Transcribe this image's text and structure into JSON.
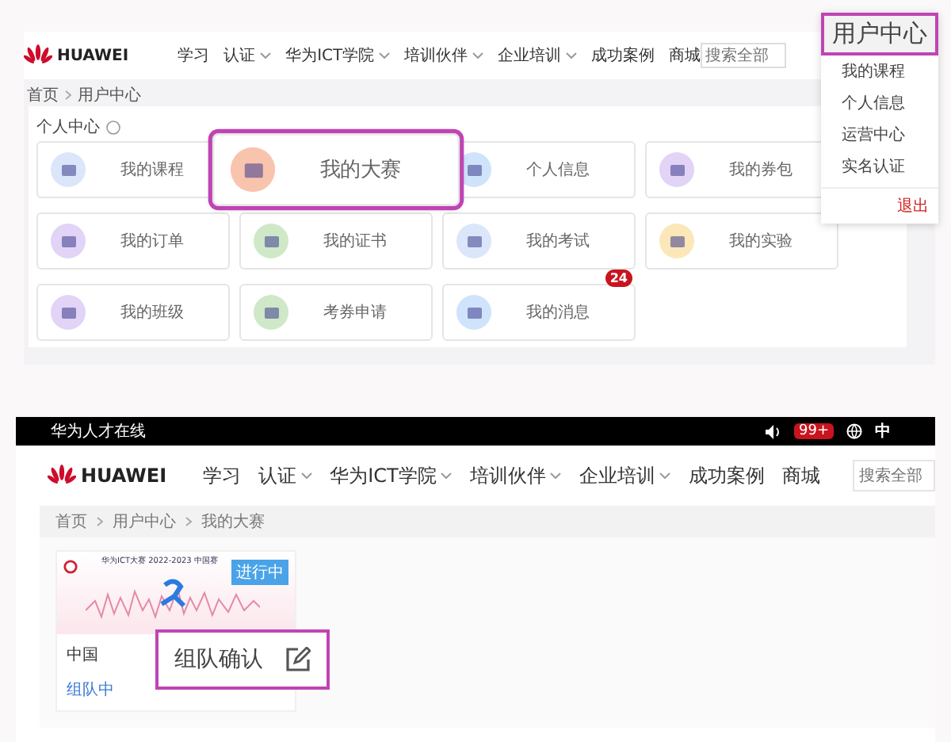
{
  "top": {
    "logo": "HUAWEI",
    "nav": [
      {
        "label": "学习",
        "dropdown": false
      },
      {
        "label": "认证",
        "dropdown": true
      },
      {
        "label": "华为ICT学院",
        "dropdown": true
      },
      {
        "label": "培训伙伴",
        "dropdown": true
      },
      {
        "label": "企业培训",
        "dropdown": true
      },
      {
        "label": "成功案例",
        "dropdown": false
      },
      {
        "label": "商城",
        "dropdown": false
      }
    ],
    "search": {
      "placeholder": "搜索全部"
    },
    "breadcrumb": [
      "首页",
      "用户中心"
    ],
    "section_title": "个人中心",
    "tiles": [
      {
        "label": "我的课程",
        "color": "#dbe6fb",
        "highlighted": false
      },
      {
        "label": "我的大赛",
        "color": "#f9c4ae",
        "highlighted": true
      },
      {
        "label": "个人信息",
        "color": "#cfe3fb",
        "highlighted": false
      },
      {
        "label": "我的券包",
        "color": "#e1d4f7",
        "highlighted": false
      },
      {
        "label": "我的订单",
        "color": "#e1d4f7",
        "highlighted": false
      },
      {
        "label": "我的证书",
        "color": "#cfe8c8",
        "highlighted": false
      },
      {
        "label": "我的考试",
        "color": "#dbe6fb",
        "highlighted": false
      },
      {
        "label": "我的实验",
        "color": "#fbe7b8",
        "highlighted": false
      },
      {
        "label": "我的班级",
        "color": "#e1d4f7",
        "highlighted": false
      },
      {
        "label": "考券申请",
        "color": "#cfe8c8",
        "highlighted": false
      },
      {
        "label": "我的消息",
        "color": "#cfe3fb",
        "highlighted": false,
        "badge": "24"
      }
    ],
    "user_menu": {
      "title": "用户中心",
      "items": [
        "我的课程",
        "个人信息",
        "运营中心",
        "实名认证"
      ],
      "logout": "退出"
    }
  },
  "bottom": {
    "topbar": {
      "site": "华为人才在线",
      "badge": "99+",
      "language": {
        "label": "中",
        "selected": true
      }
    },
    "logo": "HUAWEI",
    "nav": [
      {
        "label": "学习",
        "dropdown": false
      },
      {
        "label": "认证",
        "dropdown": true
      },
      {
        "label": "华为ICT学院",
        "dropdown": true
      },
      {
        "label": "培训伙伴",
        "dropdown": true
      },
      {
        "label": "企业培训",
        "dropdown": true
      },
      {
        "label": "成功案例",
        "dropdown": false
      },
      {
        "label": "商城",
        "dropdown": false
      }
    ],
    "search": {
      "placeholder": "搜索全部"
    },
    "breadcrumb": [
      "首页",
      "用户中心",
      "我的大赛"
    ],
    "competition": {
      "banner_title": "华为ICT大赛 2022-2023 中国赛",
      "status": "进行中",
      "name": "中国",
      "team_status": "组队中"
    },
    "callout": {
      "label": "组队确认"
    }
  }
}
